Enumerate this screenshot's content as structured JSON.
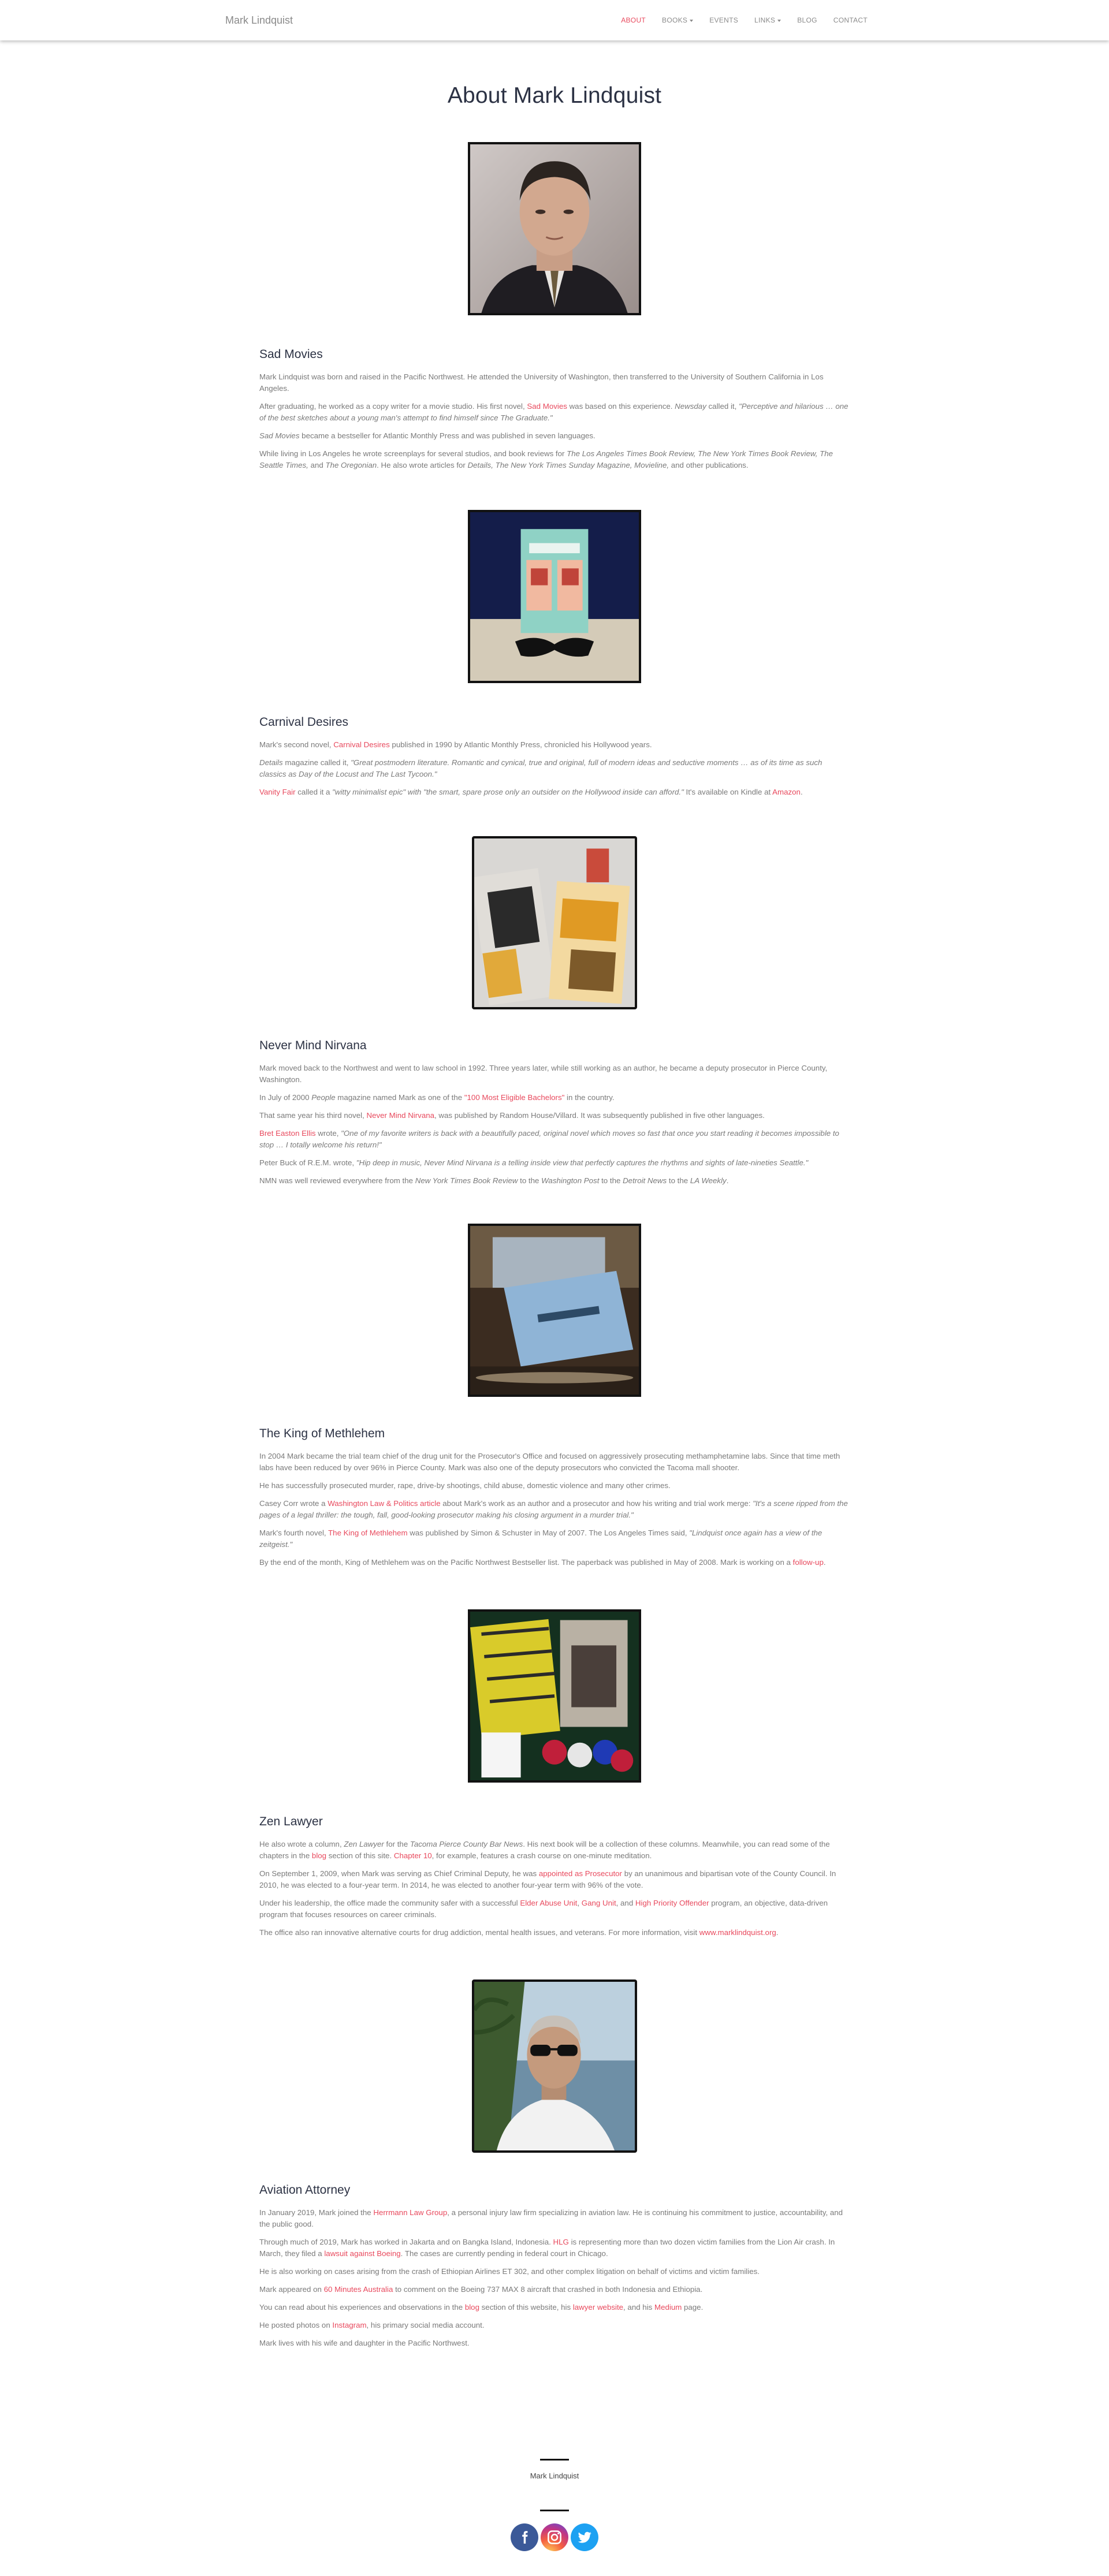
{
  "nav": {
    "brand": "Mark Lindquist",
    "items": [
      "ABOUT",
      "BOOKS",
      "EVENTS",
      "LINKS",
      "BLOG",
      "CONTACT"
    ]
  },
  "page": {
    "title": "About Mark Lindquist"
  },
  "sad_movies": {
    "heading": "Sad Movies",
    "p1": "Mark Lindquist was born and raised in the Pacific Northwest. He attended the University of Washington, then transferred to the University of Southern California in Los Angeles.",
    "p2a": "After graduating, he worked as a copy writer for a movie studio. His first novel, ",
    "p2link": "Sad Movies",
    "p2b": " was based on this experience. ",
    "p2em1": "Newsday",
    "p2c": " called it, ",
    "p2em2": "\"Perceptive and hilarious … one of the best sketches about a young man's attempt to find himself since The Graduate.\"",
    "p3em": "Sad Movies",
    "p3": " became a bestseller for Atlantic Monthly Press and was published in seven languages.",
    "p4a": "While living in Los Angeles he wrote screenplays for several studios, and book reviews for ",
    "p4em": "The Los Angeles Times Book Review, The New York Times Book Review, The Seattle Times,",
    "p4b": " and ",
    "p4em2": "The Oregonian",
    "p4c": ". He also wrote articles for ",
    "p4em3": "Details, The New York Times Sunday Magazine, Movieline,",
    "p4d": " and other publications."
  },
  "carnival": {
    "heading": "Carnival Desires",
    "p1a": "Mark's second novel, ",
    "p1link": "Carnival Desires",
    "p1b": " published in 1990 by Atlantic Monthly Press, chronicled his Hollywood years.",
    "p2a": "Details",
    "p2b": " magazine called it, ",
    "p2em": "\"Great postmodern literature. Romantic and cynical, true and original, full of modern ideas and seductive moments … as of its time as such classics as Day of the Locust and The Last Tycoon.\"",
    "p3link": "Vanity Fair",
    "p3a": " called it a ",
    "p3em": "\"witty minimalist epic\" with \"the smart, spare prose only an outsider on the Hollywood inside can afford.\"",
    "p3b": " It's available on Kindle at ",
    "p3link2": "Amazon",
    "p3c": "."
  },
  "nirvana": {
    "heading": "Never Mind Nirvana",
    "p1": "Mark moved back to the Northwest and went to law school in 1992. Three years later, while still working as an author, he became a deputy prosecutor in Pierce County, Washington.",
    "p2a": "In July of 2000 ",
    "p2em": "People",
    "p2b": " magazine named Mark as one of the ",
    "p2link": "\"100 Most Eligible Bachelors\"",
    "p2c": " in the country.",
    "p3a": "That same year his third novel, ",
    "p3link": "Never Mind Nirvana",
    "p3b": ", was published by Random House/Villard. It was subsequently published in five other languages.",
    "p4link": "Bret Easton Ellis",
    "p4a": " wrote, ",
    "p4em": "\"One of my favorite writers is back with a beautifully paced, original novel which moves so fast that once you start reading it becomes impossible to stop … I totally welcome his return!\"",
    "p5a": "Peter Buck of R.E.M. wrote, ",
    "p5em": "\"Hip deep in music, Never Mind Nirvana is a telling inside view that perfectly captures the rhythms and sights of late-nineties Seattle.\"",
    "p6a": "NMN was well reviewed everywhere from the ",
    "p6em": "New York Times Book Review",
    "p6b": " to the ",
    "p6em2": "Washington Post",
    "p6c": " to the ",
    "p6em3": "Detroit News",
    "p6d": " to the ",
    "p6em4": "LA Weekly",
    "p6e": "."
  },
  "methlehem": {
    "heading": "The King of Methlehem",
    "p1": "In 2004 Mark became the trial team chief of the drug unit for the Prosecutor's Office and focused on aggressively prosecuting methamphetamine labs. Since that time meth labs have been reduced by over 96% in Pierce County. Mark was also one of the deputy prosecutors who convicted the Tacoma mall shooter.",
    "p2": "He has successfully prosecuted murder, rape, drive-by shootings, child abuse, domestic violence and many other crimes.",
    "p3a": "Casey Corr wrote a ",
    "p3link": "Washington Law & Politics article",
    "p3b": " about Mark's work as an author and a prosecutor and how his writing and trial work merge: ",
    "p3em": "\"It's a scene ripped from the pages of a legal thriller: the tough, fall, good-looking prosecutor making his closing argument in a murder trial.\"",
    "p4a": "Mark's fourth novel, ",
    "p4link": "The King of Methlehem",
    "p4b": " was published by Simon & Schuster in May of 2007. The Los Angeles Times said, ",
    "p4em": "\"Lindquist once again has a view of the zeitgeist.\"",
    "p5a": "By the end of the month, King of Methlehem was on the Pacific Northwest Bestseller list. The paperback was published in May of 2008.  Mark is working on a ",
    "p5link": "follow-up",
    "p5b": "."
  },
  "zen": {
    "heading": "Zen Lawyer",
    "p1a": "He also wrote a column, ",
    "p1em": "Zen Lawyer",
    "p1b": " for the ",
    "p1em2": "Tacoma Pierce County Bar News",
    "p1c": ". His next book will be a collection of these columns. Meanwhile, you can read some of the chapters in the ",
    "p1link": "blog",
    "p1d": " section of this site. ",
    "p1link2": "Chapter 10",
    "p1e": ", for example, features a crash course on one-minute meditation.",
    "p2a": "On September 1, 2009, when Mark was serving as Chief Criminal Deputy, he was ",
    "p2link": "appointed as Prosecutor",
    "p2b": " by an unanimous and bipartisan vote of the County Council. In 2010, he was elected to a four-year term. In 2014, he was elected to another four-year term with 96% of the vote.",
    "p3a": "Under his leadership, the office made the community safer with a successful ",
    "p3link": "Elder Abuse Unit",
    "p3b": ", ",
    "p3link2": "Gang Unit",
    "p3c": ", and ",
    "p3link3": "High Priority Offender",
    "p3d": " program, an objective, data-driven program that focuses resources on career criminals.",
    "p4a": "The office also ran innovative alternative courts for drug addiction, mental health issues, and veterans. For more information, visit ",
    "p4link": "www.marklindquist.org",
    "p4b": "."
  },
  "aviation": {
    "heading": "Aviation Attorney",
    "p1a": "In January 2019, Mark joined the ",
    "p1link": "Herrmann Law Group",
    "p1b": ", a personal injury law firm specializing in aviation law. He is continuing his commitment to justice, accountability, and the public good.",
    "p2a": "Through much of 2019, Mark has worked in Jakarta and on Bangka Island, Indonesia. ",
    "p2link": "HLG",
    "p2b": " is representing more than two dozen victim families from the Lion Air crash. In March, they filed a ",
    "p2link2": "lawsuit against Boeing",
    "p2c": ". The cases are currently pending in federal court in Chicago.",
    "p3": "He is also working on cases arising from the crash of Ethiopian Airlines ET 302, and other complex litigation on behalf of victims and victim families.",
    "p4a": "Mark appeared on ",
    "p4link": "60 Minutes Australia",
    "p4b": " to comment on the Boeing 737 MAX 8 aircraft that crashed in both Indonesia and Ethiopia.",
    "p5a": "You can read about his experiences and observations in the ",
    "p5link": "blog",
    "p5b": " section of this website, his ",
    "p5link2": "lawyer website",
    "p5c": ", and his ",
    "p5link3": "Medium",
    "p5d": " page.",
    "p6a": "He posted photos on ",
    "p6link": "Instagram",
    "p6b": ", his primary social media account.",
    "p7": "Mark lives with his wife and daughter in the Pacific Northwest."
  },
  "footer": {
    "name": "Mark Lindquist",
    "social": [
      "facebook-icon",
      "instagram-icon",
      "twitter-icon"
    ]
  },
  "colors": {
    "accent": "#e8495d",
    "heading": "#2c3244",
    "text": "#7a7a7a"
  }
}
